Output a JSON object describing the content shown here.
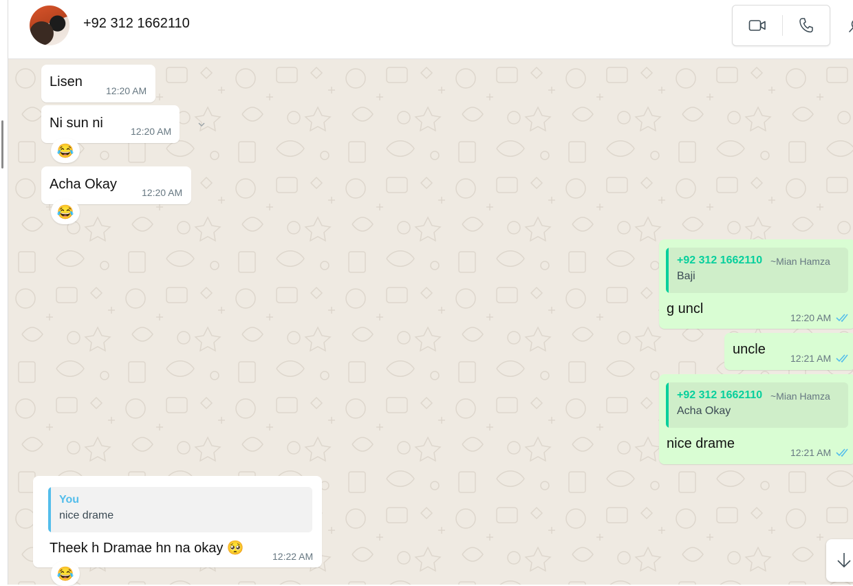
{
  "header": {
    "contact_name": "+92 312 1662110",
    "icons": [
      "video-call-icon",
      "voice-call-icon",
      "search-icon"
    ]
  },
  "colors": {
    "outgoing_bubble": "#d9fdd3",
    "incoming_bubble": "#ffffff",
    "chat_background": "#efeae2",
    "quote_accent_green": "#06cf9c",
    "quote_accent_blue": "#53bdeb",
    "read_ticks": "#53bdeb",
    "timestamp": "#667781"
  },
  "messages": [
    {
      "id": "m1",
      "direction": "incoming",
      "text": "Lisen",
      "time": "12:20 AM"
    },
    {
      "id": "m2",
      "direction": "incoming",
      "text": "Ni sun ni",
      "time": "12:20 AM",
      "reaction": "😂"
    },
    {
      "id": "m3",
      "direction": "incoming",
      "text": "Acha Okay",
      "time": "12:20 AM",
      "reaction": "😂"
    },
    {
      "id": "m4",
      "direction": "outgoing",
      "text": "g uncl",
      "time": "12:20 AM",
      "status": "read",
      "quote": {
        "author": "+92 312 1662110",
        "author_name": "~Mian Hamza",
        "text": "Baji"
      }
    },
    {
      "id": "m5",
      "direction": "outgoing",
      "text": "uncle",
      "time": "12:21 AM",
      "status": "read"
    },
    {
      "id": "m6",
      "direction": "outgoing",
      "text": "nice drame",
      "time": "12:21 AM",
      "status": "read",
      "quote": {
        "author": "+92 312 1662110",
        "author_name": "~Mian Hamza",
        "text": "Acha Okay"
      }
    },
    {
      "id": "m7",
      "direction": "incoming",
      "text": "Theek h Dramae hn na okay 🥺",
      "time": "12:22 AM",
      "reaction": "😂",
      "quote": {
        "author": "You",
        "text": "nice drame"
      }
    }
  ]
}
